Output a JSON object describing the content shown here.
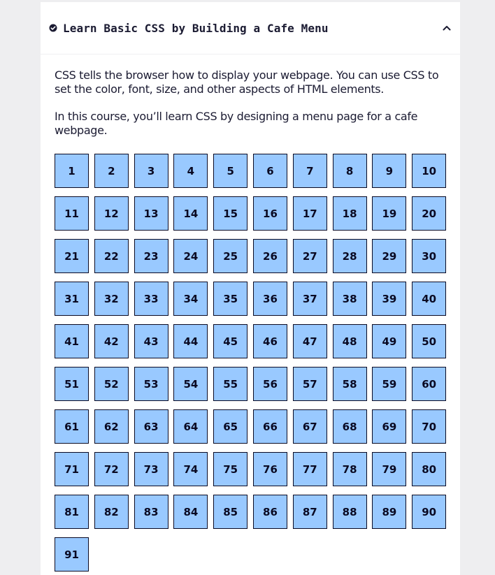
{
  "header": {
    "title": "Learn Basic CSS by Building a Cafe Menu",
    "check_icon": "check-circle-icon",
    "chevron_icon": "chevron-up-icon"
  },
  "description": [
    "CSS tells the browser how to display your webpage. You can use CSS to set the color, font, size, and other aspects of HTML elements.",
    "In this course, you’ll learn CSS by designing a menu page for a cafe webpage."
  ],
  "steps": [
    "1",
    "2",
    "3",
    "4",
    "5",
    "6",
    "7",
    "8",
    "9",
    "10",
    "11",
    "12",
    "13",
    "14",
    "15",
    "16",
    "17",
    "18",
    "19",
    "20",
    "21",
    "22",
    "23",
    "24",
    "25",
    "26",
    "27",
    "28",
    "29",
    "30",
    "31",
    "32",
    "33",
    "34",
    "35",
    "36",
    "37",
    "38",
    "39",
    "40",
    "41",
    "42",
    "43",
    "44",
    "45",
    "46",
    "47",
    "48",
    "49",
    "50",
    "51",
    "52",
    "53",
    "54",
    "55",
    "56",
    "57",
    "58",
    "59",
    "60",
    "61",
    "62",
    "63",
    "64",
    "65",
    "66",
    "67",
    "68",
    "69",
    "70",
    "71",
    "72",
    "73",
    "74",
    "75",
    "76",
    "77",
    "78",
    "79",
    "80",
    "81",
    "82",
    "83",
    "84",
    "85",
    "86",
    "87",
    "88",
    "89",
    "90",
    "91"
  ],
  "colors": {
    "step_bg": "#99c9ff",
    "step_border": "#0a0a23",
    "text": "#1b1b32",
    "page_bg": "#eeeef0"
  }
}
